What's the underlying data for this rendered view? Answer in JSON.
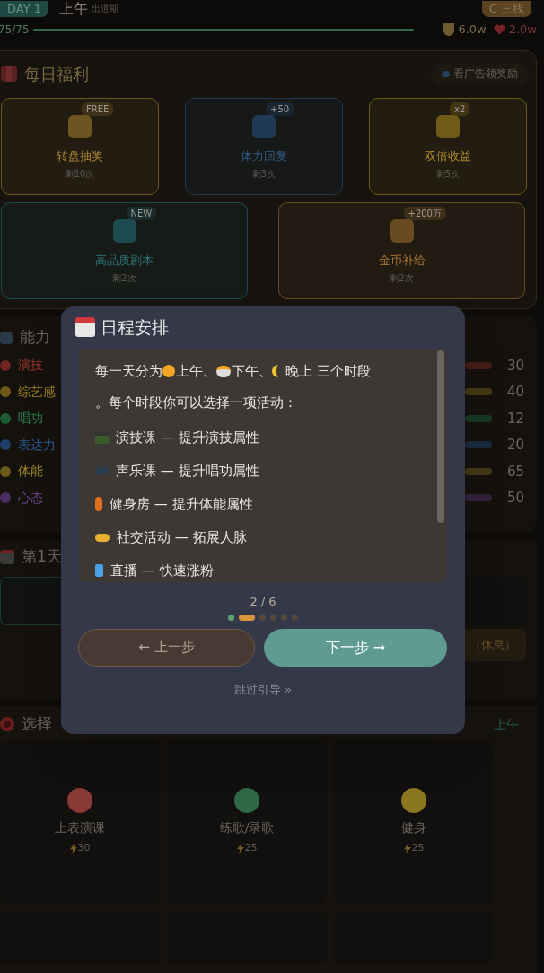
{
  "header": {
    "day": "DAY 1",
    "period": "上午",
    "stage": "出道期",
    "tier": "C 三线",
    "energy": "75/75",
    "coins": "6.0w",
    "fans": "2.0w"
  },
  "daily": {
    "title": "每日福利",
    "ad_button": "看广告领奖励",
    "cards": [
      {
        "badge": "FREE",
        "name": "转盘抽奖",
        "remaining": "剩10次",
        "color": "#6e5420"
      },
      {
        "badge": "+50",
        "name": "体力回复",
        "remaining": "剩3次",
        "color": "#1f3a54"
      },
      {
        "badge": "x2",
        "name": "双倍收益",
        "remaining": "剩5次",
        "color": "#705a18"
      },
      {
        "badge": "NEW",
        "name": "高品质剧本",
        "remaining": "剩2次",
        "color": "#1d4a4e"
      },
      {
        "badge": "+200万",
        "name": "金币补给",
        "remaining": "剩2次",
        "color": "#6a4a20"
      }
    ]
  },
  "abilities": {
    "title": "能力",
    "stats": [
      {
        "name": "演技",
        "value": "30",
        "color": "#6e2620"
      },
      {
        "name": "综艺感",
        "value": "40",
        "color": "#6e5a18"
      },
      {
        "name": "唱功",
        "value": "12",
        "color": "#1e5a35"
      },
      {
        "name": "表达力",
        "value": "20",
        "color": "#1e3f66"
      },
      {
        "name": "体能",
        "value": "65",
        "color": "#6a5a1c"
      },
      {
        "name": "心态",
        "value": "50",
        "color": "#4a2e62"
      }
    ]
  },
  "schedule": {
    "title": "第1天",
    "rest_button": "（休息）"
  },
  "activities": {
    "title": "选择",
    "period": "上午",
    "items": [
      {
        "name": "上表演课",
        "cost": "30",
        "color": "#8a3a35"
      },
      {
        "name": "练歌/录歌",
        "cost": "25",
        "color": "#2f6a45"
      },
      {
        "name": "健身",
        "cost": "25",
        "color": "#8a7520"
      }
    ]
  },
  "dialog": {
    "title": "日程安排",
    "intro": [
      "每一天分为 ",
      "上午、",
      "下午、",
      "晚上 三个时段"
    ],
    "intro_tail": "。每个时段你可以选择一项活动：",
    "lines": [
      "演技课 — 提升演技属性",
      "声乐课 — 提升唱功属性",
      "健身房 — 提升体能属性",
      "社交活动 — 拓展人脉",
      "直播 — 快速涨粉"
    ],
    "page": "2 / 6",
    "dots": [
      {
        "selected": false,
        "done": true
      },
      {
        "selected": true,
        "done": false
      },
      {
        "selected": false,
        "done": false
      },
      {
        "selected": false,
        "done": false
      },
      {
        "selected": false,
        "done": false
      },
      {
        "selected": false,
        "done": false
      }
    ],
    "prev_button": "← 上一步",
    "next_button": "下一步 →",
    "skip_link": "跳过引导 »"
  }
}
